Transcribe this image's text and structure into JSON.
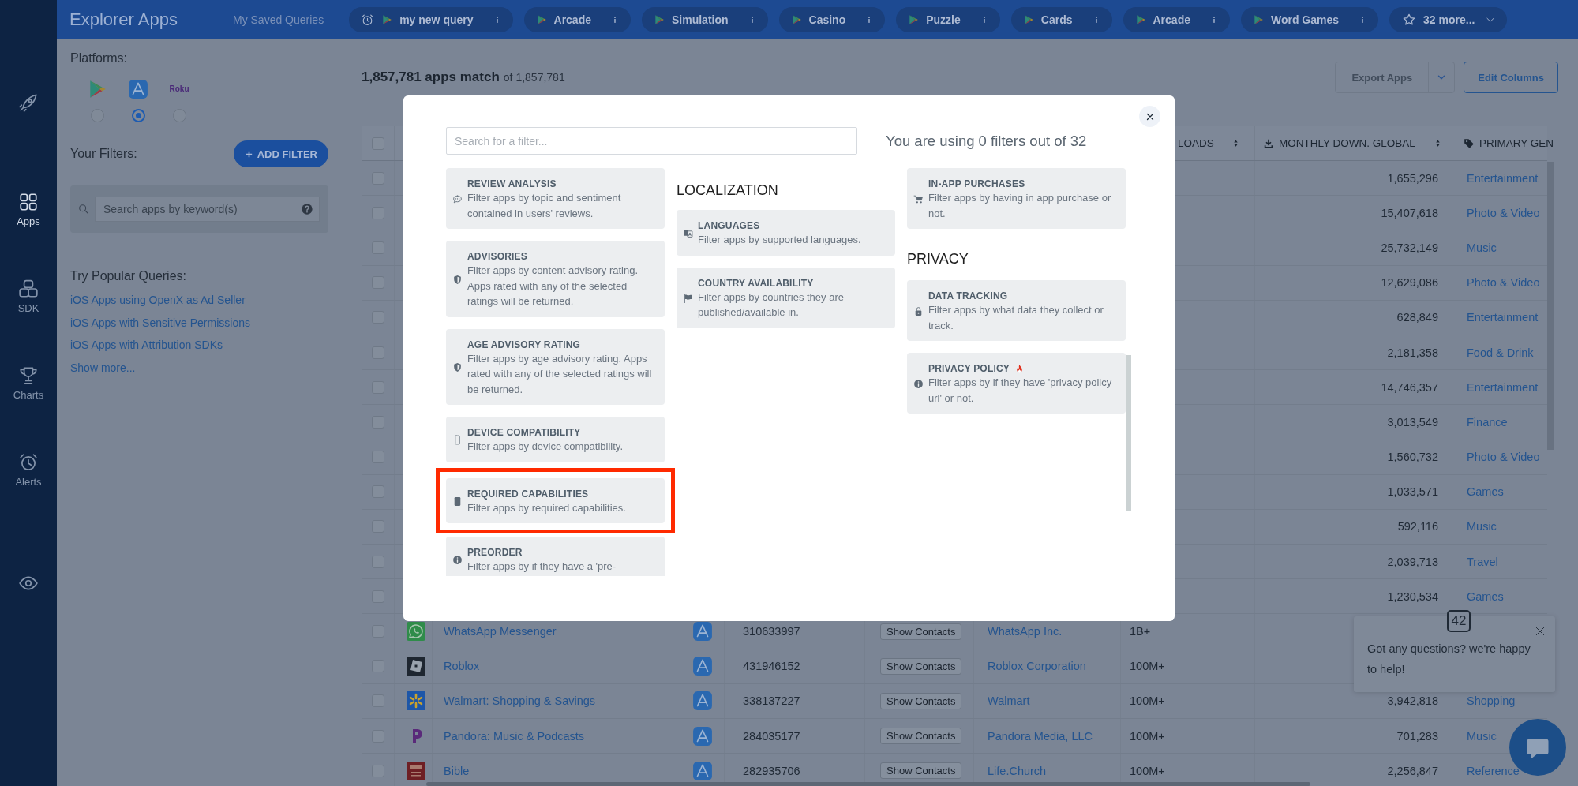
{
  "nav": [
    {
      "kind": "rocket",
      "selected": false
    },
    {
      "kind": "apps",
      "label": "Apps",
      "selected": true
    },
    {
      "kind": "sdk",
      "label": "SDK",
      "selected": false
    },
    {
      "kind": "charts",
      "label": "Charts",
      "selected": false
    },
    {
      "kind": "alerts",
      "label": "Alerts",
      "selected": false
    },
    {
      "kind": "eye",
      "selected": false
    }
  ],
  "top_bar": {
    "title": "Explorer Apps",
    "saved_label": "My Saved Queries",
    "queries": [
      {
        "label": "my new query",
        "alarm": true
      },
      {
        "label": "Arcade",
        "alarm": false
      },
      {
        "label": "Simulation",
        "alarm": false
      },
      {
        "label": "Casino",
        "alarm": false
      },
      {
        "label": "Puzzle",
        "alarm": false
      },
      {
        "label": "Cards",
        "alarm": false
      },
      {
        "label": "Arcade",
        "alarm": false
      },
      {
        "label": "Word Games",
        "alarm": false
      }
    ],
    "more": "32 more..."
  },
  "filter_panel": {
    "platforms_label": "Platforms:",
    "platforms": [
      {
        "kind": "play",
        "selected": false
      },
      {
        "kind": "appstore",
        "selected": true
      },
      {
        "kind": "roku",
        "label": "Roku",
        "selected": false
      }
    ],
    "filters_label": "Your Filters:",
    "add_filter": "ADD FILTER",
    "keyword_search": {
      "placeholder": "Search apps by keyword(s)"
    },
    "popular_label": "Try Popular Queries:",
    "popular": [
      "iOS Apps using OpenX as Ad Seller",
      "iOS Apps with Sensitive Permissions",
      "iOS Apps with Attribution SDKs"
    ],
    "show_more": "Show more..."
  },
  "results": {
    "count": "1,857,781 apps match",
    "total": "of 1,857,781",
    "export": "Export Apps",
    "edit_columns": "Edit Columns"
  },
  "table": {
    "select_all": {
      "checked": false
    },
    "columns": [
      {
        "kind": "downloads",
        "label": "LOADS"
      },
      {
        "kind": "monthly",
        "label": "MONTHLY DOWN. GLOBAL"
      },
      {
        "kind": "genre",
        "label": "PRIMARY GEN"
      }
    ],
    "rows": [
      {
        "checked": false,
        "monthly": "1,655,296",
        "genre": "Entertainment"
      },
      {
        "checked": false,
        "monthly": "15,407,618",
        "genre": "Photo & Video"
      },
      {
        "checked": false,
        "monthly": "25,732,149",
        "genre": "Music"
      },
      {
        "checked": false,
        "monthly": "12,629,086",
        "genre": "Photo & Video"
      },
      {
        "checked": false,
        "monthly": "628,849",
        "genre": "Entertainment"
      },
      {
        "checked": false,
        "monthly": "2,181,358",
        "genre": "Food & Drink"
      },
      {
        "checked": false,
        "monthly": "14,746,357",
        "genre": "Entertainment"
      },
      {
        "checked": false,
        "monthly": "3,013,549",
        "genre": "Finance"
      },
      {
        "checked": false,
        "monthly": "1,560,732",
        "genre": "Photo & Video"
      },
      {
        "checked": false,
        "monthly": "1,033,571",
        "genre": "Games"
      },
      {
        "checked": false,
        "monthly": "592,116",
        "genre": "Music"
      },
      {
        "checked": false,
        "monthly": "2,039,713",
        "genre": "Travel"
      },
      {
        "checked": false,
        "monthly": "1,230,534",
        "genre": "Games"
      },
      {
        "checked": false,
        "kind": "bubble",
        "name": "WhatsApp Messenger",
        "app_id": "310633997",
        "contacts": "Show Contacts",
        "publisher": "WhatsApp Inc.",
        "downloads": "1B+"
      },
      {
        "checked": false,
        "kind": "square",
        "name": "Roblox",
        "app_id": "431946152",
        "contacts": "Show Contacts",
        "publisher": "Roblox Corporation",
        "downloads": "100M+"
      },
      {
        "checked": false,
        "kind": "spark",
        "name": "Walmart: Shopping & Savings",
        "app_id": "338137227",
        "contacts": "Show Contacts",
        "publisher": "Walmart",
        "downloads": "100M+",
        "monthly": "3,942,818",
        "genre": "Shopping"
      },
      {
        "checked": false,
        "kind": "pennant",
        "name": "Pandora: Music & Podcasts",
        "app_id": "284035177",
        "contacts": "Show Contacts",
        "publisher": "Pandora Media, LLC",
        "downloads": "100M+",
        "monthly": "701,283",
        "genre": "Music"
      },
      {
        "checked": false,
        "kind": "book",
        "name": "Bible",
        "app_id": "282935706",
        "contacts": "Show Contacts",
        "publisher": "Life.Church",
        "downloads": "100M+",
        "monthly": "2,256,847",
        "genre": "Reference"
      }
    ]
  },
  "filter_dialog": {
    "search": {
      "placeholder": "Search for a filter..."
    },
    "usage": "You are using 0 filters out of 32",
    "columns": [
      {
        "sections": [
          {
            "cards": [
              {
                "kind": "comment",
                "title": "REVIEW ANALYSIS",
                "description": "Filter apps by topic and sentiment contained in users' reviews.",
                "hot": false,
                "highlighted": false
              },
              {
                "kind": "shield",
                "title": "ADVISORIES",
                "description": "Filter apps by content advisory rating. Apps rated with any of the selected ratings will be returned.",
                "hot": false,
                "highlighted": false
              },
              {
                "kind": "shield",
                "title": "AGE ADVISORY RATING",
                "description": "Filter apps by age advisory rating. Apps rated with any of the selected ratings will be returned.",
                "hot": false,
                "highlighted": false
              },
              {
                "kind": "mobile",
                "title": "DEVICE COMPATIBILITY",
                "description": "Filter apps by device compatibility.",
                "hot": false,
                "highlighted": false
              },
              {
                "kind": "tablet",
                "title": "REQUIRED CAPABILITIES",
                "description": "Filter apps by required capabilities.",
                "hot": false,
                "highlighted": true
              },
              {
                "kind": "info",
                "title": "PREORDER",
                "description": "Filter apps by if they have a 'pre-",
                "hot": false,
                "highlighted": false
              }
            ]
          }
        ]
      },
      {
        "sections": [
          {
            "heading": "LOCALIZATION",
            "cards": [
              {
                "kind": "language",
                "title": "LANGUAGES",
                "description": "Filter apps by supported languages.",
                "hot": false,
                "highlighted": false
              },
              {
                "kind": "flag",
                "title": "COUNTRY AVAILABILITY",
                "description": "Filter apps by countries they are published/available in.",
                "hot": false,
                "highlighted": false
              }
            ]
          }
        ]
      },
      {
        "sections": [
          {
            "cards": [
              {
                "kind": "cart",
                "title": "IN-APP PURCHASES",
                "description": "Filter apps by having in app purchase or not.",
                "hot": false,
                "highlighted": false
              }
            ]
          },
          {
            "heading": "PRIVACY",
            "cards": [
              {
                "kind": "lock",
                "title": "DATA TRACKING",
                "description": "Filter apps by what data they collect or track.",
                "hot": false,
                "highlighted": false
              },
              {
                "kind": "info",
                "title": "PRIVACY POLICY",
                "description": "Filter apps by if they have 'privacy policy url' or not.",
                "hot": true,
                "highlighted": false
              }
            ]
          }
        ]
      }
    ]
  },
  "chat_widget": {
    "badge": "42",
    "message": "Got any questions? we're happy to help!"
  }
}
